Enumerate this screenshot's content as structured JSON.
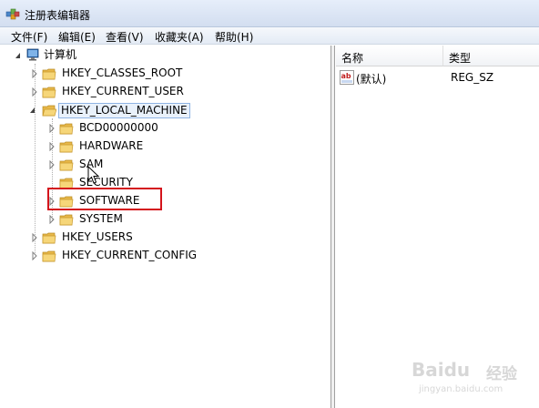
{
  "window": {
    "title": "注册表编辑器"
  },
  "menu": [
    "文件(F)",
    "编辑(E)",
    "查看(V)",
    "收藏夹(A)",
    "帮助(H)"
  ],
  "tree": {
    "root": "计算机",
    "hives": {
      "classes_root": "HKEY_CLASSES_ROOT",
      "current_user": "HKEY_CURRENT_USER",
      "local_machine": "HKEY_LOCAL_MACHINE",
      "users": "HKEY_USERS",
      "current_config": "HKEY_CURRENT_CONFIG"
    },
    "local_machine_children": [
      "BCD00000000",
      "HARDWARE",
      "SAM",
      "SECURITY",
      "SOFTWARE",
      "SYSTEM"
    ]
  },
  "list": {
    "columns": {
      "name": "名称",
      "type": "类型"
    },
    "rows": [
      {
        "name": "(默认)",
        "type": "REG_SZ"
      }
    ]
  },
  "watermark": {
    "brand": "Baidu",
    "cn": "经验",
    "sub": "jingyan.baidu.com"
  },
  "colors": {
    "highlight_box": "#d4141c",
    "selection_border": "#8fb4e3"
  },
  "icons": {
    "app": "registry-editor-icon",
    "folder": "folder-icon",
    "value": "string-value-icon"
  }
}
